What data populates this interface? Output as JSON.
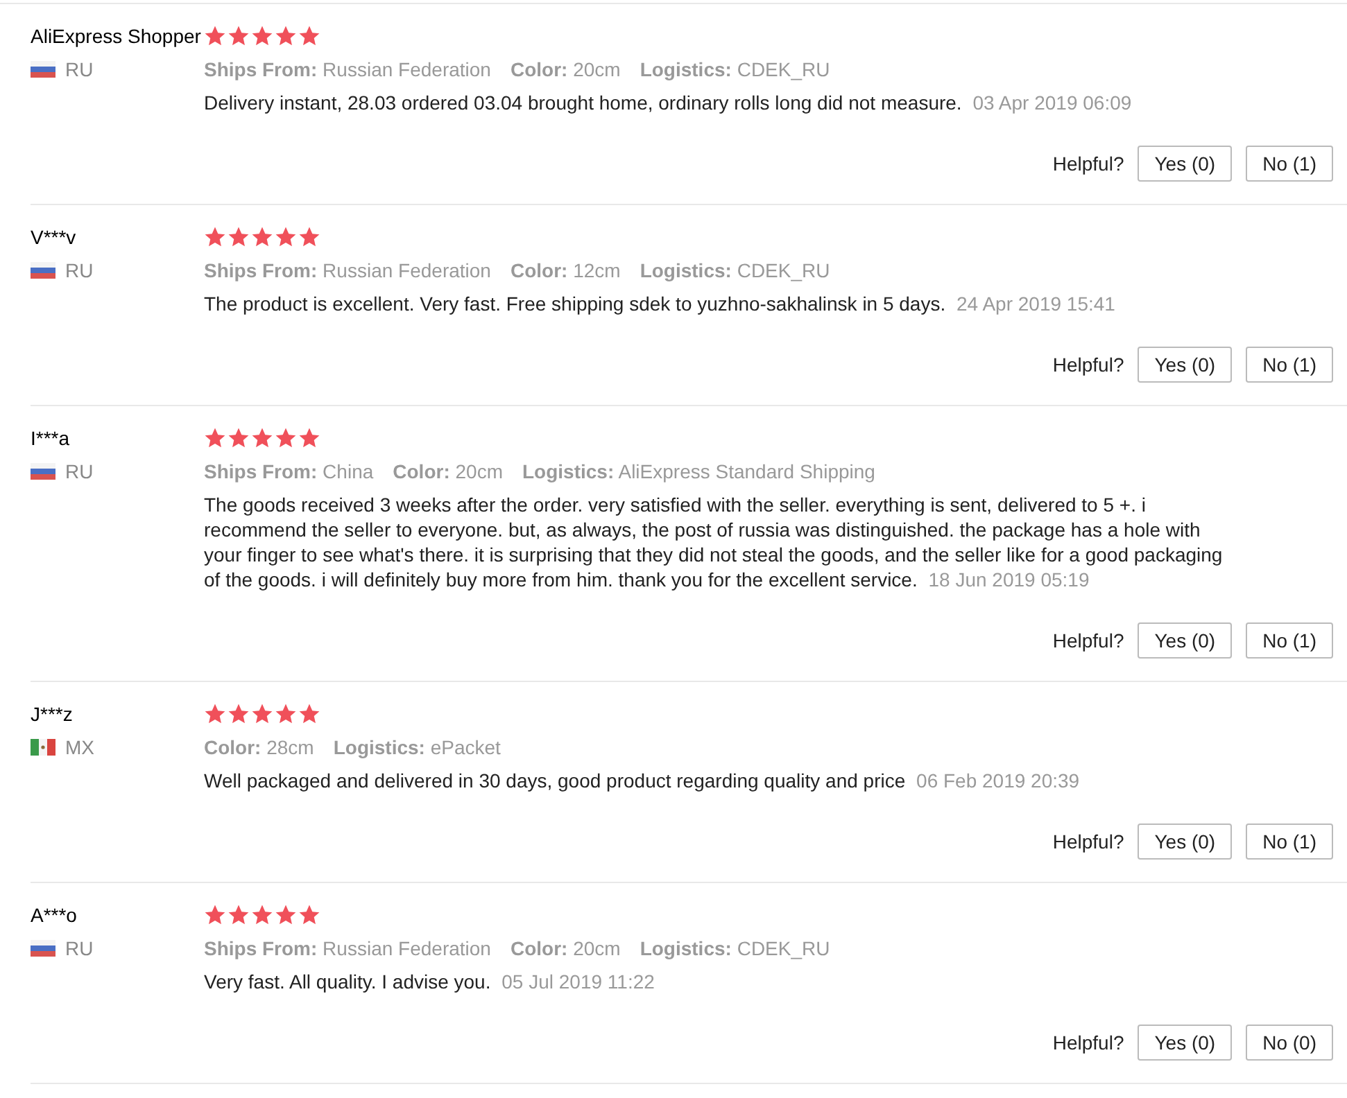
{
  "reviews": [
    {
      "name": "AliExpress Shopper",
      "kind": "ru",
      "country": "RU",
      "stars": 5,
      "attributes": [
        "**Ships From:** Russian Federation",
        "**Color:** 20cm",
        "**Logistics:** CDEK_RU"
      ],
      "text": "Delivery instant, 28.03 ordered 03.04 brought home, ordinary rolls long did not measure.",
      "date": "03 Apr 2019 06:09",
      "helpful_label": "Helpful?",
      "yes_button": "Yes (0)",
      "no_button": "No (1)"
    },
    {
      "name": "V***v",
      "kind": "ru",
      "country": "RU",
      "stars": 5,
      "attributes": [
        "**Ships From:** Russian Federation",
        "**Color:** 12cm",
        "**Logistics:** CDEK_RU"
      ],
      "text": "The product is excellent. Very fast. Free shipping sdek to yuzhno-sakhalinsk in 5 days.",
      "date": "24 Apr 2019 15:41",
      "helpful_label": "Helpful?",
      "yes_button": "Yes (0)",
      "no_button": "No (1)"
    },
    {
      "name": "I***a",
      "kind": "ru",
      "country": "RU",
      "stars": 5,
      "attributes": [
        "**Ships From:** China",
        "**Color:** 20cm",
        "**Logistics:** AliExpress Standard Shipping"
      ],
      "text": "The goods received 3 weeks after the order. very satisfied with the seller. everything is sent, delivered to 5 +. i recommend the seller to everyone. but, as always, the post of russia was distinguished. the package has a hole with your finger to see what's there. it is surprising that they did not steal the goods, and the seller like for a good packaging of the goods. i will definitely buy more from him. thank you for the excellent service.",
      "date": "18 Jun 2019 05:19",
      "helpful_label": "Helpful?",
      "yes_button": "Yes (0)",
      "no_button": "No (1)"
    },
    {
      "name": "J***z",
      "kind": "mx",
      "country": "MX",
      "stars": 5,
      "attributes": [
        "**Color:** 28cm",
        "**Logistics:** ePacket"
      ],
      "text": "Well packaged and delivered in 30 days, good product regarding quality and price",
      "date": "06 Feb 2019 20:39",
      "helpful_label": "Helpful?",
      "yes_button": "Yes (0)",
      "no_button": "No (1)"
    },
    {
      "name": "A***o",
      "kind": "ru",
      "country": "RU",
      "stars": 5,
      "attributes": [
        "**Ships From:** Russian Federation",
        "**Color:** 20cm",
        "**Logistics:** CDEK_RU"
      ],
      "text": "Very fast. All quality. I advise you.",
      "date": "05 Jul 2019 11:22",
      "helpful_label": "Helpful?",
      "yes_button": "Yes (0)",
      "no_button": "No (0)"
    }
  ]
}
